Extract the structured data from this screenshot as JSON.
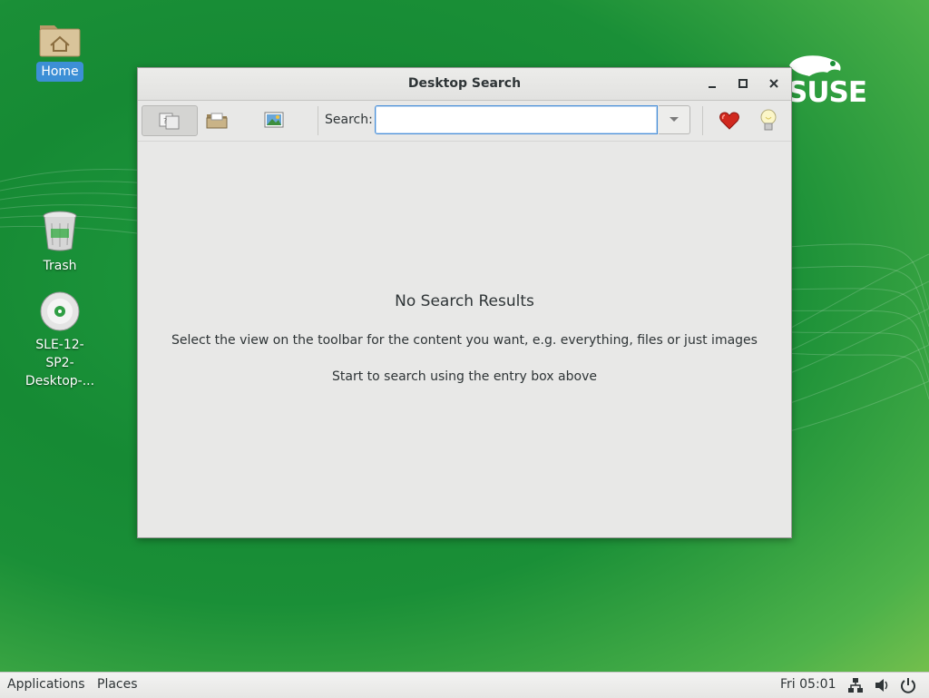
{
  "desktop": {
    "icons": [
      {
        "label": "Home",
        "icon": "home-folder-icon"
      },
      {
        "label": "Trash",
        "icon": "trash-icon"
      },
      {
        "label": "SLE-12-SP2-Desktop-...",
        "label_lines": [
          "SLE-12-",
          "SP2-",
          "Desktop-..."
        ],
        "icon": "disc-icon"
      }
    ],
    "brand": "SUSE"
  },
  "window": {
    "title": "Desktop Search",
    "controls": {
      "minimize": "minimize-icon",
      "maximize": "maximize-icon",
      "close": "close-icon"
    },
    "toolbar": {
      "views": [
        {
          "name": "everything",
          "icon": "everything-view-icon",
          "active": true
        },
        {
          "name": "files",
          "icon": "folder-view-icon",
          "active": false
        },
        {
          "name": "images",
          "icon": "images-view-icon",
          "active": false
        }
      ],
      "search_label": "Search:",
      "search_value": "",
      "search_placeholder": "",
      "favorites_icon": "heart-icon",
      "tips_icon": "lightbulb-icon"
    },
    "content": {
      "heading": "No Search Results",
      "hint_views": "Select the view on the toolbar for the content you want, e.g. everything, files or just images",
      "hint_search": "Start to search using the entry box above"
    }
  },
  "panel": {
    "applications": "Applications",
    "places": "Places",
    "clock": "Fri 05:01",
    "tray": [
      "network-icon",
      "volume-icon",
      "power-icon"
    ]
  },
  "colors": {
    "desktop_green": "#1a8f37",
    "selection_blue": "#3d8fd6",
    "focus_blue": "#4a90d9"
  }
}
